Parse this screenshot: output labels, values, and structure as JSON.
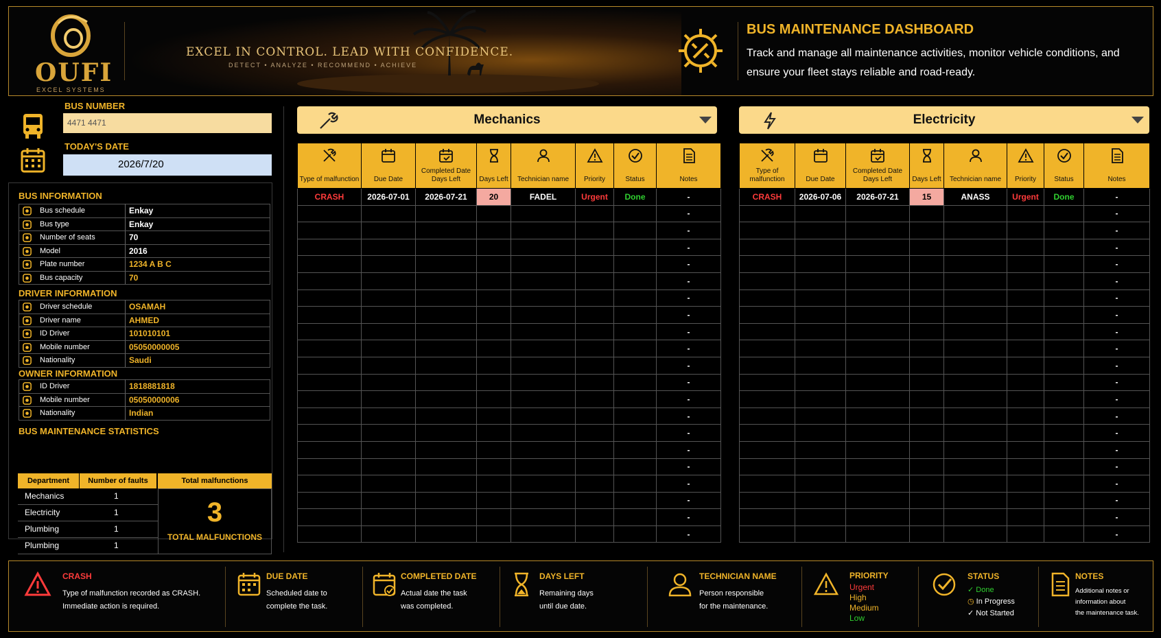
{
  "header": {
    "logo": "OUFI",
    "logo_sub": "EXCEL SYSTEMS",
    "slogan": "EXCEL IN CONTROL. LEAD WITH CONFIDENCE.",
    "tagline": "DETECT  •  ANALYZE  •  RECOMMEND  •  ACHIEVE",
    "title": "BUS MAINTENANCE DASHBOARD",
    "description": "Track and manage all maintenance activities, monitor vehicle conditions, and ensure your fleet stays reliable and road-ready."
  },
  "left": {
    "bus_number_label": "BUS NUMBER",
    "bus_number_value": "4471      4471",
    "date_label": "TODAY'S DATE",
    "date_value": "2026/7/20",
    "bus_info": {
      "title": "BUS INFORMATION",
      "rows": [
        {
          "label": "Bus schedule",
          "value": "Enkay",
          "icon": "bus-icon"
        },
        {
          "label": "Bus type",
          "value": "Enkay",
          "icon": "bus-front-icon"
        },
        {
          "label": "Number of seats",
          "value": "70",
          "icon": "seat-icon"
        },
        {
          "label": "Model",
          "value": "2016",
          "icon": "model-icon"
        },
        {
          "label": "Plate number",
          "value": "1234 A B C",
          "icon": "plate-icon"
        },
        {
          "label": "Bus capacity",
          "value": "70",
          "icon": "car-icon"
        }
      ]
    },
    "driver_info": {
      "title": "DRIVER INFORMATION",
      "rows": [
        {
          "label": "Driver schedule",
          "value": "OSAMAH",
          "icon": "user-icon"
        },
        {
          "label": "Driver name",
          "value": "AHMED",
          "icon": "user-icon"
        },
        {
          "label": "ID Driver",
          "value": "101010101",
          "icon": "id-icon"
        },
        {
          "label": "Mobile number",
          "value": "05050000005",
          "icon": "phone-icon"
        },
        {
          "label": "Nationality",
          "value": "Saudi",
          "icon": "globe-icon"
        }
      ]
    },
    "owner_info": {
      "title": "OWNER INFORMATION",
      "rows": [
        {
          "label": "ID Driver",
          "value": "1818881818",
          "icon": "id-icon"
        },
        {
          "label": "Mobile number",
          "value": "05050000006",
          "icon": "phone-icon"
        },
        {
          "label": "Nationality",
          "value": "Indian",
          "icon": "globe-icon"
        }
      ]
    },
    "stats": {
      "title": "BUS MAINTENANCE STATISTICS",
      "col_department": "Department",
      "col_faults": "Number of faults",
      "col_total": "Total malfunctions",
      "rows": [
        {
          "department": "Mechanics",
          "faults": "1"
        },
        {
          "department": "Electricity",
          "faults": "1"
        },
        {
          "department": "Plumbing",
          "faults": "1"
        },
        {
          "department": "Plumbing",
          "faults": "1"
        }
      ],
      "total": "3",
      "total_label": "TOTAL MALFUNCTIONS"
    }
  },
  "columns": [
    "Type of malfunction",
    "Due Date",
    "Completed Date Days Left",
    "Days Left",
    "Technician name",
    "Priority",
    "Status",
    "Notes"
  ],
  "mechanics": {
    "title": "Mechanics",
    "row": {
      "type": "CRASH",
      "due": "2026-07-01",
      "completed": "2026-07-21",
      "days": "20",
      "tech": "FADEL",
      "priority": "Urgent",
      "status": "Done",
      "notes": "-"
    },
    "empty_note": "-"
  },
  "electricity": {
    "title": "Electricity",
    "row": {
      "type": "CRASH",
      "due": "2026-07-06",
      "completed": "2026-07-21",
      "days": "15",
      "tech": "ANASS",
      "priority": "Urgent",
      "status": "Done",
      "notes": "-"
    },
    "empty_note": "-"
  },
  "footer": {
    "crash": {
      "title": "CRASH",
      "l1": "Type of malfunction recorded as CRASH.",
      "l2": "Immediate action is required."
    },
    "due": {
      "title": "DUE DATE",
      "l1": "Scheduled date to",
      "l2": "complete the task."
    },
    "completed": {
      "title": "COMPLETED DATE",
      "l1": "Actual date the task",
      "l2": "was completed."
    },
    "days": {
      "title": "DAYS LEFT",
      "l1": "Remaining days",
      "l2": "until due date."
    },
    "tech": {
      "title": "TECHNICIAN NAME",
      "l1": "Person responsible",
      "l2": "for the maintenance."
    },
    "priority": {
      "title": "PRIORITY",
      "urgent": "Urgent",
      "high": "High",
      "medium": "Medium",
      "low": "Low"
    },
    "status": {
      "title": "STATUS",
      "done": "Done",
      "progress": "In Progress",
      "not_started": "Not Started"
    },
    "notes": {
      "title": "NOTES",
      "l1": "Additional notes or",
      "l2": "information about",
      "l3": "the maintenance task."
    }
  },
  "colors": {
    "accent": "#f0b429",
    "urgent": "#ff3b3b",
    "done": "#30d030",
    "days_bg": "#f4a9a0"
  }
}
